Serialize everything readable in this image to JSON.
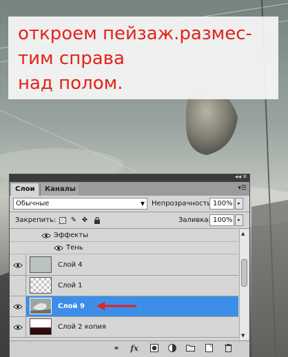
{
  "caption": {
    "lines": [
      "откроем пейзаж.размес-",
      "тим справа",
      "над полом."
    ],
    "color": "#e2231a"
  },
  "panel": {
    "tabs": [
      "Слои",
      "Каналы"
    ],
    "blend_mode": "Обычные",
    "opacity_label": "Непрозрачность:",
    "opacity_value": "100%",
    "lock_label": "Закрепить:",
    "fill_label": "Заливка:",
    "fill_value": "100%",
    "effects_label": "Эффекты",
    "shadow_label": "Тень",
    "layers": [
      {
        "name": "Слой 4",
        "visible": true,
        "selected": false
      },
      {
        "name": "Слой 1",
        "visible": false,
        "selected": false
      },
      {
        "name": "Слой 9",
        "visible": true,
        "selected": true
      },
      {
        "name": "Слой 2 копия",
        "visible": true,
        "selected": false
      }
    ],
    "selection_color": "#3d8ee8",
    "bottom_icons": [
      "link-icon",
      "fx-icon",
      "mask-icon",
      "adjustment-icon",
      "group-icon",
      "new-layer-icon",
      "trash-icon"
    ]
  }
}
